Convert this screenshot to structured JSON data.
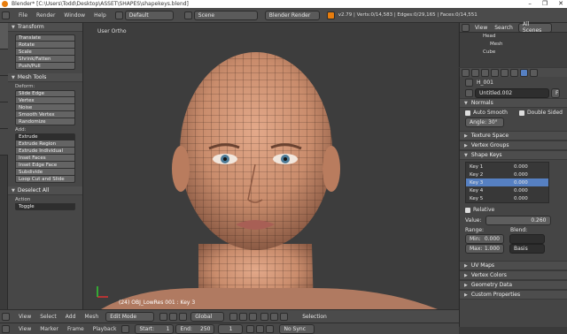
{
  "window": {
    "title": "Blender* [C:\\Users\\Todd\\Desktop\\ASSET\\SHAPES\\shapekeys.blend]",
    "buttons": [
      "–",
      "❐",
      "✕"
    ]
  },
  "infobar": {
    "menus": [
      "File",
      "Render",
      "Window",
      "Help"
    ],
    "layout": "Default",
    "scene": "Scene",
    "engine": "Blender Render",
    "stats": "v2.79 | Verts:0/14,583 | Edges:0/29,165 | Faces:0/14,551"
  },
  "toolshelf": {
    "tabs": [
      "Tools",
      "Create",
      "Shading / UVs",
      "Options",
      "Grease Pencil"
    ],
    "transform": {
      "title": "Transform",
      "buttons": [
        "Translate",
        "Rotate",
        "Scale",
        "Shrink/Fatten",
        "Push/Pull"
      ]
    },
    "mesh_tools": {
      "title": "Mesh Tools",
      "deform_label": "Deform:",
      "buttons": [
        "Slide Edge",
        "Vertex",
        "Noise",
        "Smooth Vertex",
        "Randomize"
      ]
    },
    "add_label": "Add:",
    "add_select": "Extrude",
    "add_buttons": [
      "Extrude Region",
      "Extrude Individual",
      "Inset Faces",
      "Inset Edge Face",
      "Subdivide",
      "Loop Cut and Slide"
    ],
    "operator": {
      "title": "Deselect All",
      "action_label": "Action",
      "action_value": "Toggle"
    }
  },
  "viewport": {
    "view_name": "User Ortho",
    "object_label": "(24) OBJ_LowRes 001 : Key 3"
  },
  "outliner": {
    "menus": [
      "View",
      "Search"
    ],
    "filter": "All Scenes",
    "items": [
      "Head",
      "Mesh",
      "Cube"
    ]
  },
  "properties": {
    "breadcrumb": "H_001",
    "data_name": "Untitled.002",
    "data_flag": "F",
    "normals": {
      "title": "Normals",
      "auto_smooth": "Auto Smooth",
      "double_sided": "Double Sided",
      "angle": "Angle: 30°"
    },
    "panels_collapsed": [
      "Texture Space",
      "Vertex Groups"
    ],
    "shape_keys": {
      "title": "Shape Keys",
      "keys": [
        {
          "name": "Key 1",
          "value": "0.000"
        },
        {
          "name": "Key 2",
          "value": "0.000"
        },
        {
          "name": "Key 3",
          "value": "0.000"
        },
        {
          "name": "Key 4",
          "value": "0.000"
        },
        {
          "name": "Key 5",
          "value": "0.000"
        }
      ],
      "relative": "Relative",
      "value_label": "Value:",
      "value": "0.260",
      "range_label": "Range:",
      "blend_label": "Blend:",
      "min_label": "Min:",
      "min_value": "0.000",
      "max_label": "Max:",
      "max_value": "1.000",
      "basis": "Basis"
    },
    "bottom_panels": [
      "UV Maps",
      "Vertex Colors",
      "Geometry Data",
      "Custom Properties"
    ]
  },
  "bottombar": {
    "menus": [
      "View",
      "Select",
      "Add",
      "Mesh"
    ],
    "mode": "Edit Mode",
    "pivot": "Global",
    "selection_label": "Selection"
  },
  "timeline": {
    "menus": [
      "View",
      "Marker",
      "Frame",
      "Playback"
    ],
    "start_label": "Start:",
    "start": "1",
    "end_label": "End:",
    "end": "250",
    "current": "1",
    "sync": "No Sync"
  },
  "colors": {
    "accent": "#5680c2",
    "skin": "#c98c6c",
    "background": "#3d3d3d"
  }
}
